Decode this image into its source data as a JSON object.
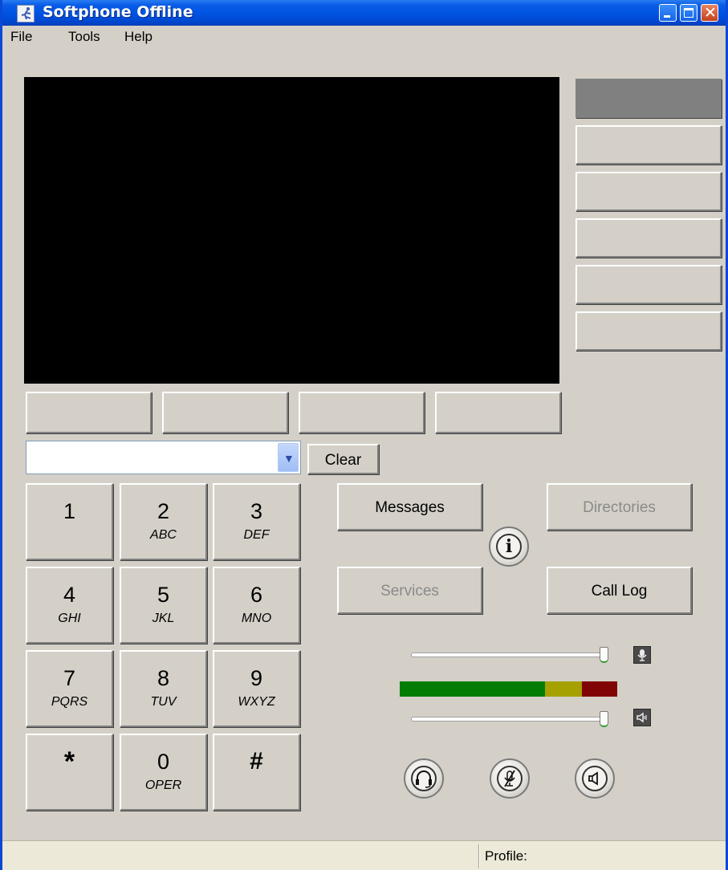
{
  "window": {
    "title": "Softphone Offline"
  },
  "menu": {
    "items": [
      "File",
      "Tools",
      "Help"
    ]
  },
  "line_buttons": [
    {
      "label": "",
      "active": true
    },
    {
      "label": "",
      "active": false
    },
    {
      "label": "",
      "active": false
    },
    {
      "label": "",
      "active": false
    },
    {
      "label": "",
      "active": false
    },
    {
      "label": "",
      "active": false
    }
  ],
  "softkeys": [
    "",
    "",
    "",
    ""
  ],
  "dial": {
    "value": "",
    "clear_label": "Clear"
  },
  "keypad": [
    {
      "digit": "1",
      "letters": ""
    },
    {
      "digit": "2",
      "letters": "ABC"
    },
    {
      "digit": "3",
      "letters": "DEF"
    },
    {
      "digit": "4",
      "letters": "GHI"
    },
    {
      "digit": "5",
      "letters": "JKL"
    },
    {
      "digit": "6",
      "letters": "MNO"
    },
    {
      "digit": "7",
      "letters": "PQRS"
    },
    {
      "digit": "8",
      "letters": "TUV"
    },
    {
      "digit": "9",
      "letters": "WXYZ"
    },
    {
      "digit": "*",
      "letters": ""
    },
    {
      "digit": "0",
      "letters": "OPER"
    },
    {
      "digit": "#",
      "letters": ""
    }
  ],
  "functions": {
    "messages": "Messages",
    "directories": "Directories",
    "services": "Services",
    "call_log": "Call Log",
    "info_icon": "info-icon"
  },
  "audio": {
    "mic_level": 0.98,
    "speaker_level": 0.98,
    "meter_colors": {
      "green": "#047d04",
      "yellow": "#a4a100",
      "red": "#820505"
    },
    "buttons": [
      "headset-icon",
      "mute-microphone-icon",
      "speaker-icon"
    ]
  },
  "status": {
    "profile_label": "Profile:"
  }
}
